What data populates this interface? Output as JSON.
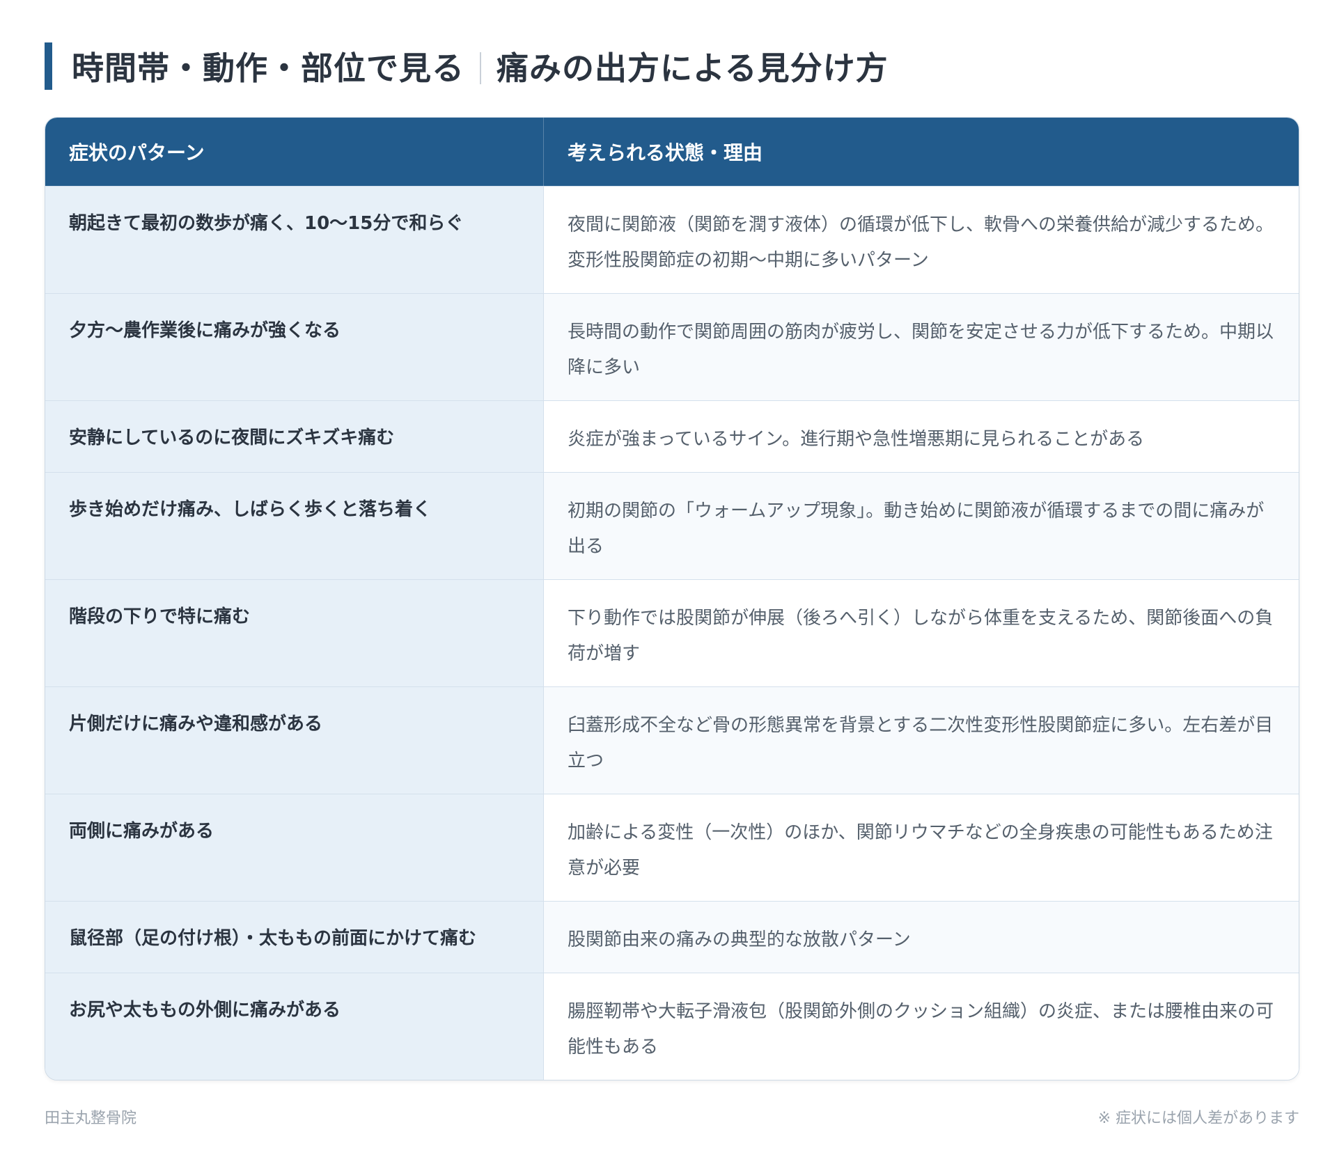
{
  "title": {
    "part1": "時間帯・動作・部位で見る",
    "part2": "痛みの出方による見分け方"
  },
  "table": {
    "headers": [
      "症状のパターン",
      "考えられる状態・理由"
    ],
    "rows": [
      {
        "pattern": "朝起きて最初の数歩が痛く、10〜15分で和らぐ",
        "reason": "夜間に関節液（関節を潤す液体）の循環が低下し、軟骨への栄養供給が減少するため。変形性股関節症の初期〜中期に多いパターン"
      },
      {
        "pattern": "夕方〜農作業後に痛みが強くなる",
        "reason": "長時間の動作で関節周囲の筋肉が疲労し、関節を安定させる力が低下するため。中期以降に多い"
      },
      {
        "pattern": "安静にしているのに夜間にズキズキ痛む",
        "reason": "炎症が強まっているサイン。進行期や急性増悪期に見られることがある"
      },
      {
        "pattern": "歩き始めだけ痛み、しばらく歩くと落ち着く",
        "reason": "初期の関節の「ウォームアップ現象」。動き始めに関節液が循環するまでの間に痛みが出る"
      },
      {
        "pattern": "階段の下りで特に痛む",
        "reason": "下り動作では股関節が伸展（後ろへ引く）しながら体重を支えるため、関節後面への負荷が増す"
      },
      {
        "pattern": "片側だけに痛みや違和感がある",
        "reason": "臼蓋形成不全など骨の形態異常を背景とする二次性変形性股関節症に多い。左右差が目立つ"
      },
      {
        "pattern": "両側に痛みがある",
        "reason": "加齢による変性（一次性）のほか、関節リウマチなどの全身疾患の可能性もあるため注意が必要"
      },
      {
        "pattern": "鼠径部（足の付け根）・太ももの前面にかけて痛む",
        "reason": "股関節由来の痛みの典型的な放散パターン"
      },
      {
        "pattern": "お尻や太ももの外側に痛みがある",
        "reason": "腸脛靭帯や大転子滑液包（股関節外側のクッション組織）の炎症、または腰椎由来の可能性もある"
      }
    ]
  },
  "footer": {
    "clinic": "田主丸整骨院",
    "note": "※ 症状には個人差があります"
  },
  "colors": {
    "accent": "#225b8c",
    "left_cell_bg": "#e7f0f8"
  }
}
